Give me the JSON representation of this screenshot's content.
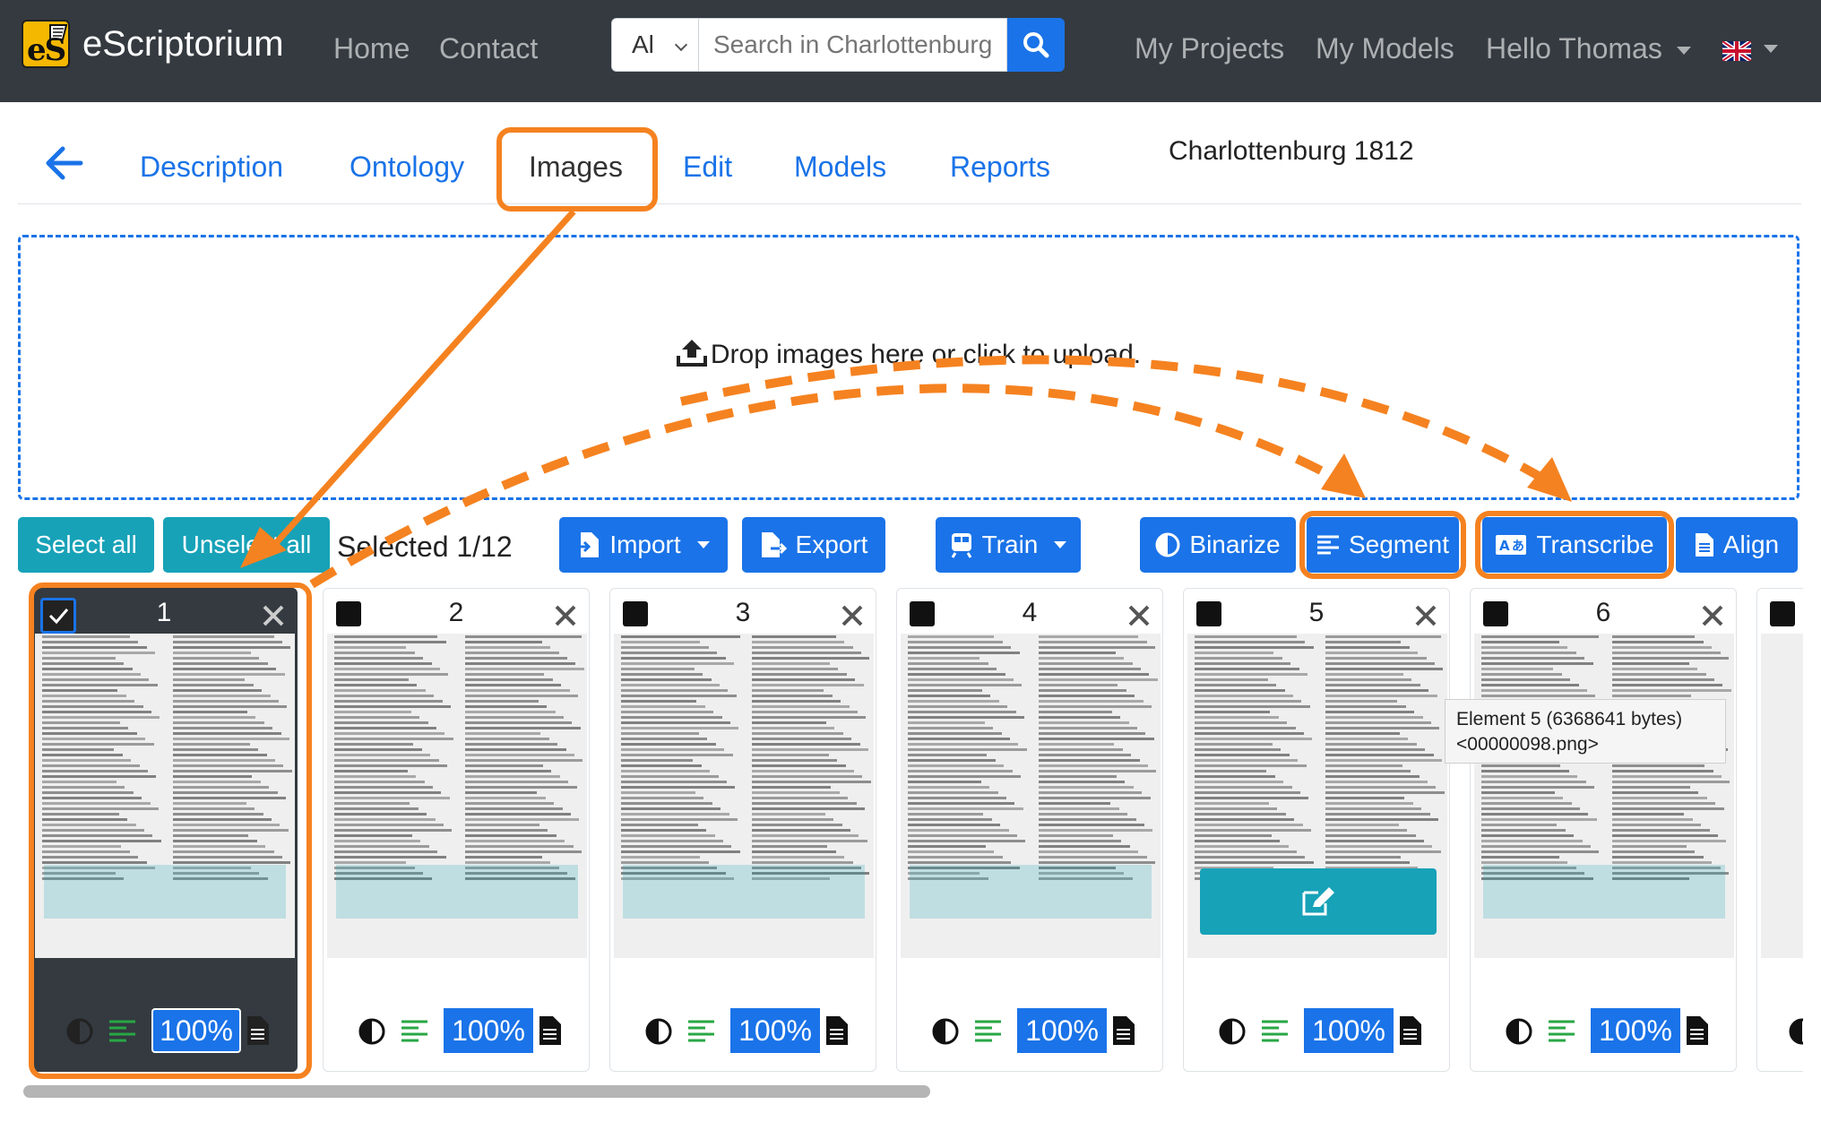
{
  "navbar": {
    "brand": "eScriptorium",
    "logo_text": "eS",
    "links": [
      "Home",
      "Contact"
    ],
    "search_scope": "Al",
    "search_placeholder": "Search in Charlottenburg",
    "my_projects": "My Projects",
    "my_models": "My Models",
    "user_menu": "Hello Thomas",
    "icons": [
      "search-icon",
      "uk-flag-icon",
      "chevron-down-icon"
    ]
  },
  "tabs": {
    "items": [
      "Description",
      "Ontology",
      "Images",
      "Edit",
      "Models",
      "Reports"
    ],
    "active": "Images"
  },
  "document_title": "Charlottenburg 1812",
  "dropzone": {
    "text": "Drop images here or click to upload."
  },
  "toolbar": {
    "select_all": "Select all",
    "unselect_all": "Unselect all",
    "selected": "Selected 1/12",
    "import": "Import",
    "export": "Export",
    "train": "Train",
    "binarize": "Binarize",
    "segment": "Segment",
    "transcribe": "Transcribe",
    "align": "Align"
  },
  "cards": [
    {
      "number": "1",
      "percent": "100%",
      "selected": true
    },
    {
      "number": "2",
      "percent": "100%",
      "selected": false
    },
    {
      "number": "3",
      "percent": "100%",
      "selected": false
    },
    {
      "number": "4",
      "percent": "100%",
      "selected": false
    },
    {
      "number": "5",
      "percent": "100%",
      "selected": false
    },
    {
      "number": "6",
      "percent": "100%",
      "selected": false
    }
  ],
  "tooltip": {
    "line1": "Element 5 (6368641 bytes)",
    "line2": "<00000098.png>"
  },
  "colors": {
    "navbar": "#343a40",
    "primary": "#1a73e8",
    "teal": "#17a2b8",
    "annotation": "#f58220",
    "segment_icon_green": "#28a745"
  }
}
